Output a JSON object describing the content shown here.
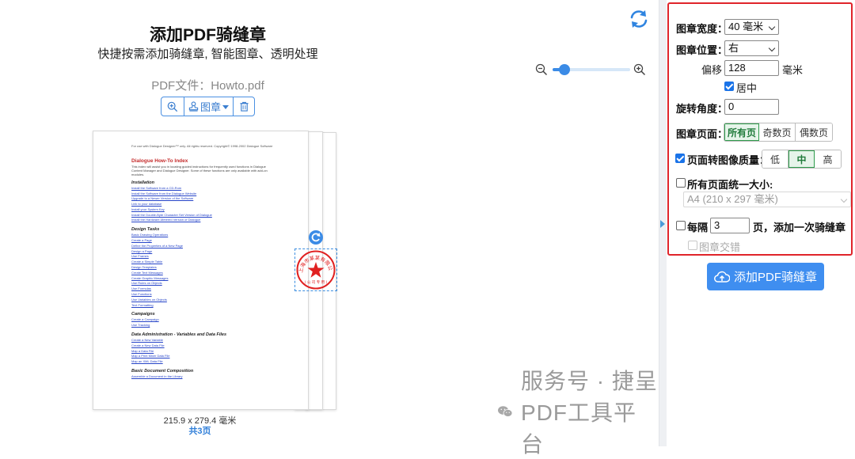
{
  "header": {
    "title": "添加PDF骑缝章",
    "subtitle": "快捷按需添加骑缝章, 智能图章、透明处理",
    "filename": "PDF文件：Howto.pdf"
  },
  "zoom": {
    "level_fraction": 0.08
  },
  "toolbar": {
    "stamp_label": "图章"
  },
  "document": {
    "header_line": "For use with Dialogue Designer™ only. All rights reserved. Copyright© 1998-2002 Dialogue Software",
    "title": "Dialogue How-To Index",
    "intro": [
      "This index will assist you in locating guided instructions for frequently used functions in Dialogue",
      "Content Manager and Dialogue Designer. Some of these functions are only available with add-on",
      "modules."
    ],
    "sections": [
      {
        "name": "Installation",
        "links": [
          "Install the Software from a CD-Rom",
          "Install the Software from the Dialogue Website",
          "Upgrade to a Newer Version of the Software",
          "Link to your database",
          "Install your System Key",
          "Install the Double-Byte Character Set Version of Dialogue",
          "Install the Hardware-Metered Version of Dialogue"
        ]
      },
      {
        "name": "Design Tasks",
        "links": [
          "Basic Drawing Operations",
          "Create a Page",
          "Define the Properties of a New Page",
          "Design a Page",
          "Use Frames",
          "Create a Simple Table",
          "Design Templates",
          "Create Text Messages",
          "Create Graphic Messages",
          "Use Rules on Objects",
          "Use Formulas",
          "Use Functions",
          "Use Variables on Objects",
          "Text Formatting"
        ]
      },
      {
        "name": "Campaigns",
        "links": [
          "Create a Campaign",
          "Use Tracking"
        ]
      },
      {
        "name": "Data Administration - Variables and Data Files",
        "links": [
          "Create a New Variable",
          "Create a New Data File",
          "Map a Data File",
          "Map a Print Mixer Data File",
          "Map an XML Data File"
        ]
      },
      {
        "name": "Basic Document Composition",
        "links": [
          "Assemble a Document in the Library"
        ]
      }
    ],
    "page_size": "215.9 x 279.4 毫米",
    "page_count": "共3页"
  },
  "stamp": {
    "ring_text": "上海市某某有限公司",
    "code": "( 公 司 专 用 )"
  },
  "watermark": {
    "text": "服务号 · 捷呈PDF工具平台"
  },
  "settings": {
    "width_label": "图章宽度：",
    "width_value": "40 毫米",
    "position_label": "图章位置：",
    "position_value": "右",
    "offset_label": "偏移",
    "offset_value": "128",
    "offset_unit": "毫米",
    "center_label": "居中",
    "center_checked": true,
    "rotation_label": "旋转角度：",
    "rotation_value": "0",
    "pages_label": "图章页面：",
    "pages_options": [
      "所有页",
      "奇数页",
      "偶数页"
    ],
    "pages_selected": "所有页",
    "quality_label": "页面转图像质量：",
    "quality_checked": true,
    "quality_options": [
      "低",
      "中",
      "高"
    ],
    "quality_selected": "中",
    "uniform_label": "所有页面统一大小:",
    "uniform_checked": false,
    "uniform_size": "A4 (210 x 297 毫米)",
    "every_prefix": "每隔",
    "every_value": "3",
    "every_suffix": "页，添加一次骑缝章",
    "every_checked": false,
    "stagger_label": "图章交错",
    "stagger_checked": false,
    "add_button": "添加PDF骑缝章"
  },
  "colors": {
    "accent": "#3f8ef0",
    "highlight_border": "#e0242a",
    "stamp_red": "#e02020",
    "active_green": "#2e9b4b"
  }
}
